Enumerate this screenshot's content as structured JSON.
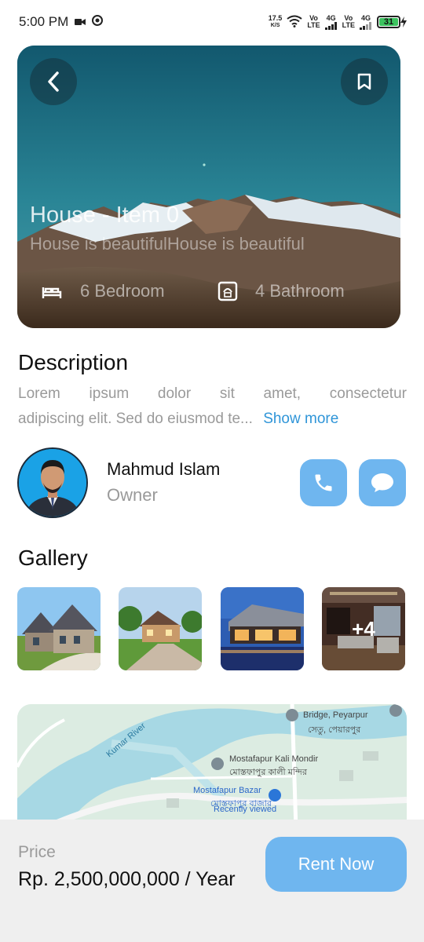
{
  "status_bar": {
    "time": "5:00 PM",
    "speed_value": "17.5",
    "speed_unit": "K/S",
    "sim1_top": "Vo",
    "sim1_bottom": "LTE",
    "sim1_network": "4G",
    "sim2_top": "Vo",
    "sim2_bottom": "LTE",
    "sim2_network": "4G",
    "battery": "31"
  },
  "hero": {
    "title": "House - Item 0",
    "subtitle": "House is beautifulHouse is beautiful",
    "bedroom_label": "6 Bedroom",
    "bathroom_label": "4 Bathroom",
    "back_icon": "chevron-left-icon",
    "bookmark_icon": "bookmark-icon"
  },
  "description": {
    "title": "Description",
    "line1_words": [
      "Lorem",
      "ipsum",
      "dolor",
      "sit",
      "amet,",
      "consectetur"
    ],
    "line2": "adipiscing elit. Sed do eiusmod te...",
    "show_more": "Show more"
  },
  "owner": {
    "name": "Mahmud Islam",
    "role": "Owner"
  },
  "gallery": {
    "title": "Gallery",
    "more_count": "+4"
  },
  "map": {
    "labels": {
      "river": "Kumar River",
      "bridge": "Bridge, Peyarpur",
      "bridge_bn": "সেতু, পেয়ারপুর",
      "kali_mondir": "Mostafapur Kali Mondir",
      "kali_mondir_bn": "মোস্তফাপুর কালী মন্দির",
      "bazar": "Mostafapur Bazar",
      "bazar_bn": "মোস্তফাপুর বাজার",
      "recently_viewed": "Recently viewed"
    }
  },
  "bottom": {
    "price_label": "Price",
    "price_value": "Rp. 2,500,000,000 / Year",
    "rent_button": "Rent Now"
  },
  "colors": {
    "accent": "#6fb6ef",
    "link": "#2f95d8",
    "muted_text": "#9a9a9a",
    "bottom_bar": "#efefef"
  }
}
